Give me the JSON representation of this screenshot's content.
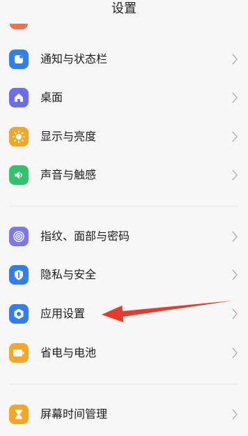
{
  "header": {
    "title": "设置"
  },
  "items": [
    {
      "label": "通知与状态栏",
      "icon": "notification-icon",
      "color": "#2f7ff3"
    },
    {
      "label": "桌面",
      "icon": "home-icon",
      "color": "#6b6df0"
    },
    {
      "label": "显示与亮度",
      "icon": "sun-icon",
      "color": "#f5a623"
    },
    {
      "label": "声音与触感",
      "icon": "speaker-icon",
      "color": "#2fc46b"
    },
    {
      "label": "指纹、面部与密码",
      "icon": "fingerprint-icon",
      "color": "#7b78ec"
    },
    {
      "label": "隐私与安全",
      "icon": "privacy-shield-icon",
      "color": "#2f7ff3"
    },
    {
      "label": "应用设置",
      "icon": "app-settings-icon",
      "color": "#2f7ff3"
    },
    {
      "label": "省电与电池",
      "icon": "battery-icon",
      "color": "#f5a623"
    },
    {
      "label": "屏幕时间管理",
      "icon": "hourglass-icon",
      "color": "#f5a623"
    }
  ],
  "annotation": {
    "arrow_color": "#e63a2a"
  }
}
